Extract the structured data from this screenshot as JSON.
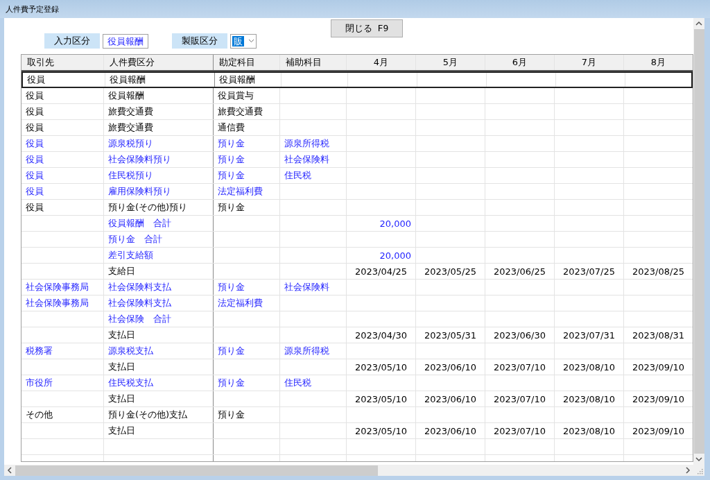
{
  "window": {
    "title": "人件費予定登録"
  },
  "close_button": {
    "label": "閉じる F9"
  },
  "filters": {
    "input_label": "入力区分",
    "input_value": "役員報酬",
    "division_label": "製販区分",
    "division_value": "販"
  },
  "table": {
    "columns": [
      "取引先",
      "人件費区分",
      "勘定科目",
      "補助科目",
      "4月",
      "5月",
      "6月",
      "7月",
      "8月"
    ],
    "rows": [
      {
        "partner": "役員",
        "category": "役員報酬",
        "account": "役員報酬",
        "highlighted": false,
        "selected": true
      },
      {
        "partner": "役員",
        "category": "役員報酬",
        "account": "役員賞与",
        "highlighted": false,
        "selected": false
      },
      {
        "partner": "役員",
        "category": "旅費交通費",
        "account": "旅費交通費",
        "highlighted": false,
        "selected": false
      },
      {
        "partner": "役員",
        "category": "旅費交通費",
        "account": "通信費",
        "highlighted": false,
        "selected": false
      },
      {
        "partner": "役員",
        "category": "源泉税預り",
        "account": "預り金",
        "sub_account": "源泉所得税",
        "highlighted": true,
        "selected": false
      },
      {
        "partner": "役員",
        "category": "社会保険料預り",
        "account": "預り金",
        "sub_account": "社会保険料",
        "highlighted": true,
        "selected": false
      },
      {
        "partner": "役員",
        "category": "住民税預り",
        "account": "預り金",
        "sub_account": "住民税",
        "highlighted": true,
        "selected": false
      },
      {
        "partner": "役員",
        "category": "雇用保険料預り",
        "account": "法定福利費",
        "highlighted": true,
        "selected": false
      },
      {
        "partner": "役員",
        "category": "預り金(その他)預り",
        "account": "預り金",
        "highlighted": false,
        "selected": false
      },
      {
        "category": "役員報酬　合計",
        "months": [
          "20,000"
        ],
        "highlighted": true,
        "selected": false
      },
      {
        "category": "預り金　合計",
        "highlighted": true,
        "selected": false
      },
      {
        "category": "差引支給額",
        "months": [
          "20,000"
        ],
        "highlighted": true,
        "selected": false
      },
      {
        "category": "支給日",
        "months": [
          "2023/04/25",
          "2023/05/25",
          "2023/06/25",
          "2023/07/25",
          "2023/08/25"
        ],
        "highlighted": false,
        "selected": false
      },
      {
        "partner": "社会保険事務局",
        "category": "社会保険料支払",
        "account": "預り金",
        "sub_account": "社会保険料",
        "highlighted": true,
        "selected": false
      },
      {
        "partner": "社会保険事務局",
        "category": "社会保険料支払",
        "account": "法定福利費",
        "highlighted": true,
        "selected": false
      },
      {
        "category": "社会保険　合計",
        "highlighted": true,
        "selected": false
      },
      {
        "category": "支払日",
        "months": [
          "2023/04/30",
          "2023/05/31",
          "2023/06/30",
          "2023/07/31",
          "2023/08/31"
        ],
        "highlighted": false,
        "selected": false
      },
      {
        "partner": "税務署",
        "category": "源泉税支払",
        "account": "預り金",
        "sub_account": "源泉所得税",
        "highlighted": true,
        "selected": false
      },
      {
        "category": "支払日",
        "months": [
          "2023/05/10",
          "2023/06/10",
          "2023/07/10",
          "2023/08/10",
          "2023/09/10"
        ],
        "highlighted": false,
        "selected": false
      },
      {
        "partner": "市役所",
        "category": "住民税支払",
        "account": "預り金",
        "sub_account": "住民税",
        "highlighted": true,
        "selected": false
      },
      {
        "category": "支払日",
        "months": [
          "2023/05/10",
          "2023/06/10",
          "2023/07/10",
          "2023/08/10",
          "2023/09/10"
        ],
        "highlighted": false,
        "selected": false
      },
      {
        "partner": "その他",
        "category": "預り金(その他)支払",
        "account": "預り金",
        "highlighted": false,
        "selected": false
      },
      {
        "category": "支払日",
        "months": [
          "2023/05/10",
          "2023/06/10",
          "2023/07/10",
          "2023/08/10",
          "2023/09/10"
        ],
        "highlighted": false,
        "selected": false
      }
    ]
  }
}
